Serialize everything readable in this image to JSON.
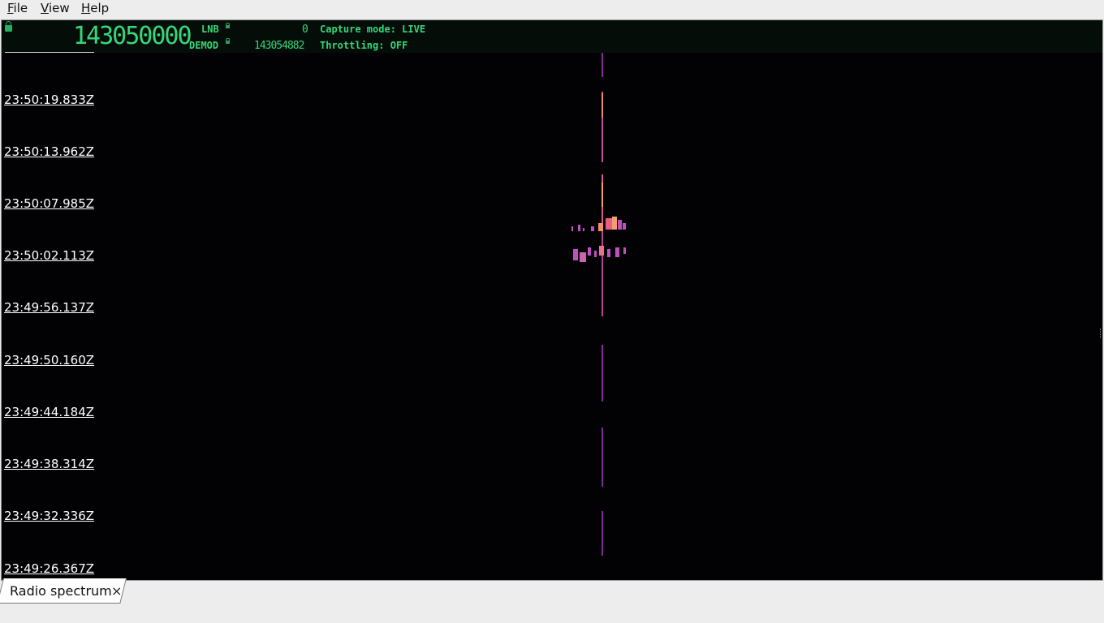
{
  "menu": {
    "file_rest": "ile",
    "file_mnemonic": "F",
    "view_rest": "iew",
    "view_mnemonic": "V",
    "help_rest": "elp",
    "help_mnemonic": "H"
  },
  "header": {
    "main_frequency": "143050000",
    "lnb_label": "LNB",
    "lnb_value": "0",
    "demod_label": "DEMOD",
    "demod_value": "143054882",
    "capture_mode": "Capture mode: LIVE",
    "throttling": "Throttling: OFF",
    "lock_icon": "lock-icon",
    "accent_color": "#36d67a"
  },
  "waterfall": {
    "timestamps": [
      "23:50:19.833Z",
      "23:50:13.962Z",
      "23:50:07.985Z",
      "23:50:02.113Z",
      "23:49:56.137Z",
      "23:49:50.160Z",
      "23:49:44.184Z",
      "23:49:38.314Z",
      "23:49:32.336Z",
      "23:49:26.367Z"
    ]
  },
  "tabs": [
    {
      "label": "Radio spectrum",
      "close_icon": "close-icon",
      "close_glyph": "×"
    }
  ]
}
